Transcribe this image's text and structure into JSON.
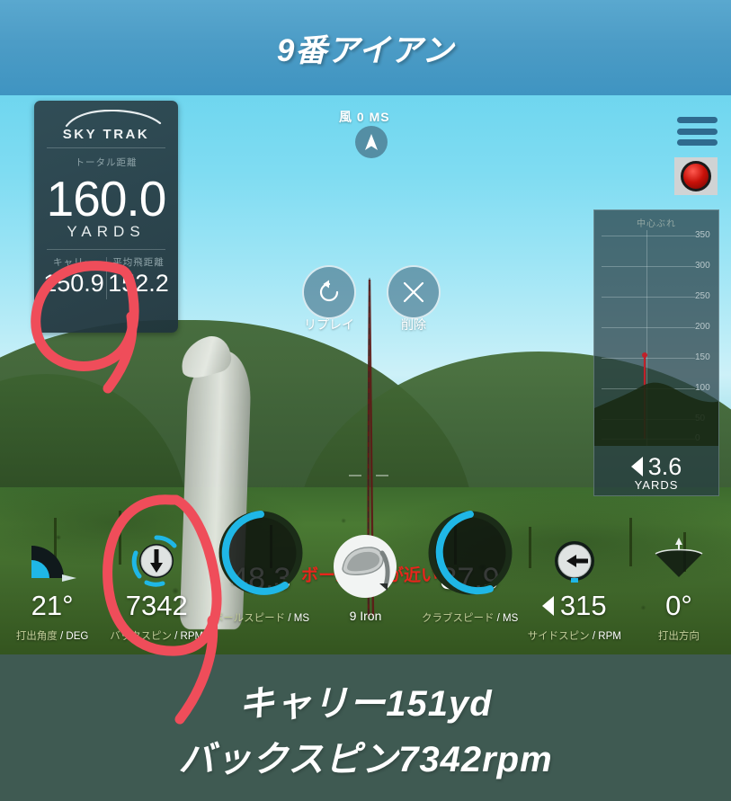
{
  "header": {
    "title": "9番アイアン"
  },
  "skytrak": {
    "brand": "SKY TRAK",
    "total_label": "トータル距離",
    "total_value": "160.0",
    "total_unit": "YARDS",
    "carry_label": "キャリー",
    "carry_value": "150.9",
    "avg_label": "平均飛距離",
    "avg_value": "152.2"
  },
  "wind": {
    "label": "風 0 MS"
  },
  "controls": {
    "replay_label": "リプレイ",
    "delete_label": "削除",
    "menu_icon": "hamburger-menu-icon",
    "record_icon": "record-button-icon"
  },
  "dispersion": {
    "title": "中心ぶれ",
    "ticks": [
      "350",
      "300",
      "250",
      "200",
      "150",
      "100",
      "50",
      "0"
    ],
    "value": "3.6",
    "unit": "YARDS",
    "direction": "left"
  },
  "scene": {
    "warning": "ボール位置が近い"
  },
  "stats": [
    {
      "icon": "launch-angle-icon",
      "value": "21°",
      "label_jp": "打出角度",
      "label_unit": "/ DEG"
    },
    {
      "icon": "backspin-ball-icon",
      "value": "7342",
      "label_jp": "バックスピン",
      "label_unit": "/ RPM"
    },
    {
      "icon": "ball-speed-gauge-icon",
      "value": "48.3",
      "label_jp": "ボールスピード",
      "label_unit": "/ MS"
    },
    {
      "icon": "golf-club-icon",
      "value": "9 Iron",
      "label_jp": "",
      "label_unit": ""
    },
    {
      "icon": "club-speed-gauge-icon",
      "value": "37.9",
      "label_jp": "クラブスピード",
      "label_unit": "/ MS"
    },
    {
      "icon": "sidespin-ball-icon",
      "value": "315",
      "label_jp": "サイドスピン",
      "label_unit": "/ RPM"
    },
    {
      "icon": "launch-direction-icon",
      "value": "0°",
      "label_jp": "打出方向",
      "label_unit": ""
    }
  ],
  "caption": {
    "line1": "キャリー151yd",
    "line2": "バックスピン7342rpm"
  },
  "colors": {
    "header_blue": "#4c9cc6",
    "accent_cyan": "#29b6e8",
    "annotation_red": "#ef4d5a",
    "warning_red": "#e8251c",
    "caption_bg": "#3f5a52",
    "panel_dark": "#2c434b"
  }
}
